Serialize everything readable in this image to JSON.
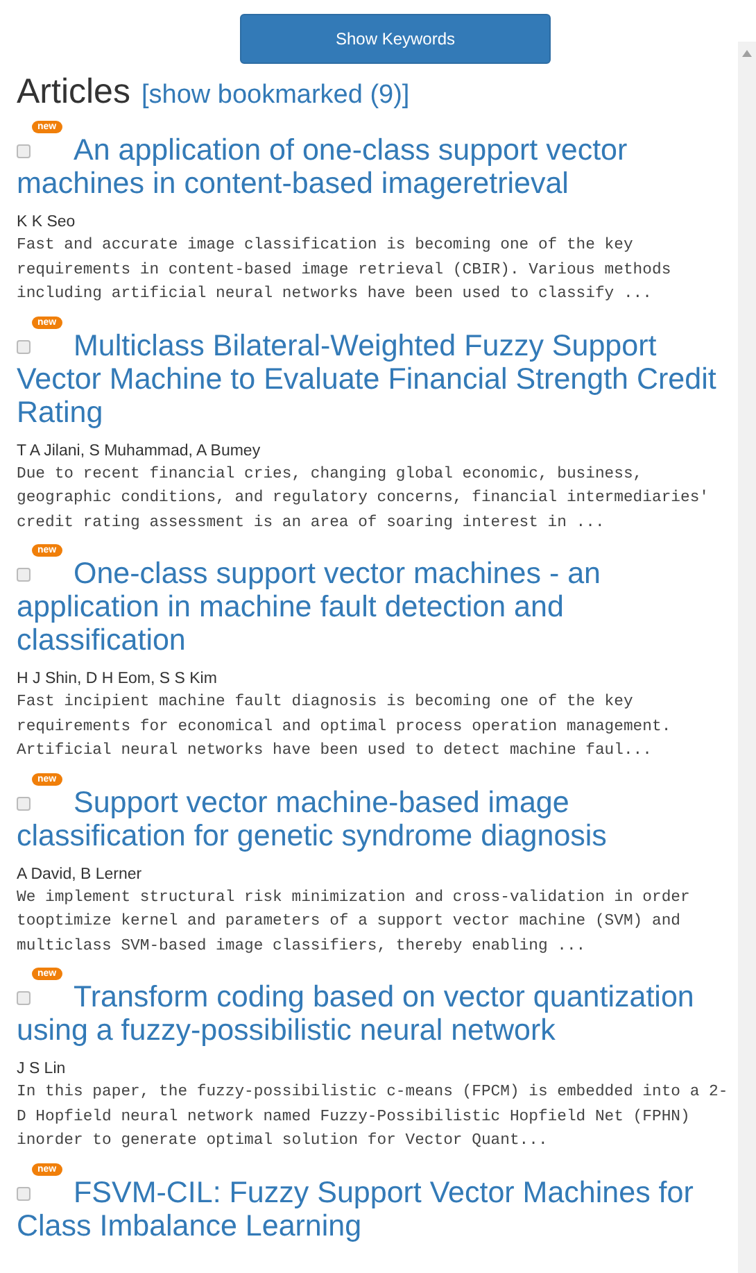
{
  "toolbar": {
    "button": "Show Keywords"
  },
  "heading": {
    "title": "Articles",
    "link": "[show bookmarked (9)]"
  },
  "articles": [
    {
      "checked": false,
      "badge": "new",
      "title": "An application of one-class support vector machines in content-based imageretrieval",
      "authors": "K K Seo",
      "abstract": "Fast and accurate image classification is becoming one of the key requirements in content-based image retrieval (CBIR). Various methods including artificial neural networks have been used to classify ..."
    },
    {
      "checked": false,
      "badge": "new",
      "title": "Multiclass Bilateral-Weighted Fuzzy Support Vector Machine to Evaluate Financial Strength Credit Rating",
      "authors": "T A Jilani, S Muhammad, A Bumey",
      "abstract": "Due to recent financial cries, changing global economic, business, geographic conditions, and regulatory concerns, financial intermediaries' credit rating assessment is an area of soaring interest in ..."
    },
    {
      "checked": false,
      "badge": "new",
      "title": "One-class support vector machines - an application in machine fault detection and classification",
      "authors": "H J Shin, D H Eom, S S Kim",
      "abstract": "Fast incipient machine fault diagnosis is becoming one of the key requirements for economical and optimal process operation management. Artificial neural networks have been used to detect machine faul..."
    },
    {
      "checked": false,
      "badge": "new",
      "title": "Support vector machine-based image classification for genetic syndrome diagnosis",
      "authors": "A David, B Lerner",
      "abstract": "We implement structural risk minimization and cross-validation in order tooptimize kernel and parameters of a support vector machine (SVM) and multiclass SVM-based image classifiers, thereby enabling ..."
    },
    {
      "checked": false,
      "badge": "new",
      "title": "Transform coding based on vector quantization using a fuzzy-possibilistic neural network",
      "authors": "J S Lin",
      "abstract": "In this paper, the fuzzy-possibilistic c-means (FPCM) is embedded into a 2-D Hopfield neural network named Fuzzy-Possibilistic Hopfield Net (FPHN) inorder to generate optimal solution for Vector Quant..."
    },
    {
      "checked": false,
      "badge": "new",
      "title": "FSVM-CIL: Fuzzy Support Vector Machines for Class Imbalance Learning"
    }
  ]
}
